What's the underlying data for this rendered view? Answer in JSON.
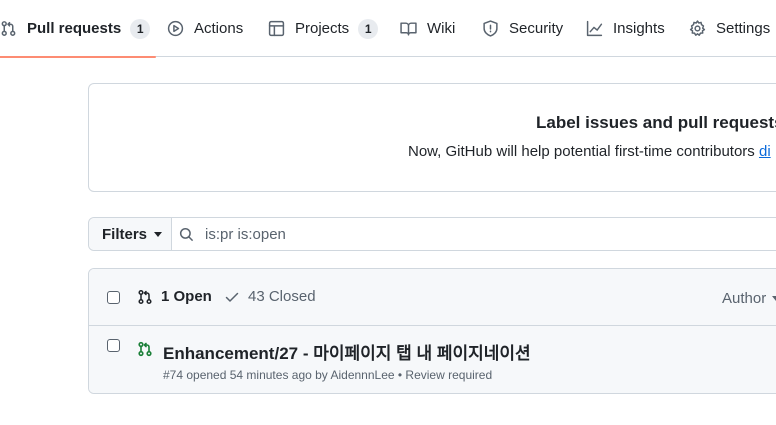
{
  "nav": {
    "pull_requests": {
      "label": "Pull requests",
      "count": "1"
    },
    "actions": {
      "label": "Actions"
    },
    "projects": {
      "label": "Projects",
      "count": "1"
    },
    "wiki": {
      "label": "Wiki"
    },
    "security": {
      "label": "Security"
    },
    "insights": {
      "label": "Insights"
    },
    "settings": {
      "label": "Settings"
    }
  },
  "blankslate": {
    "title": "Label issues and pull requests fo",
    "text": "Now, GitHub will help potential first-time contributors ",
    "link": "di"
  },
  "filter_bar": {
    "filters_label": "Filters",
    "query": "is:pr is:open"
  },
  "list": {
    "open_label": "1 Open",
    "closed_label": "43 Closed",
    "author_label": "Author",
    "rows": [
      {
        "title": "Enhancement/27 - 마이페이지 탭 내 페이지네이션",
        "number": "#74",
        "opened_text": " opened 54 minutes ago by ",
        "author": "AidennnLee",
        "status": " • Review required"
      }
    ]
  },
  "colors": {
    "active_tab_underline": "#fd8c73",
    "open_icon": "#1a7f37",
    "link": "#0969da",
    "border": "#d0d7de"
  },
  "icons": {
    "pull_requests": "git-pull-request-icon",
    "actions": "play-icon",
    "projects": "table-icon",
    "wiki": "book-icon",
    "security": "shield-icon",
    "insights": "graph-icon",
    "settings": "gear-icon",
    "search": "search-icon",
    "closed": "check-icon"
  }
}
